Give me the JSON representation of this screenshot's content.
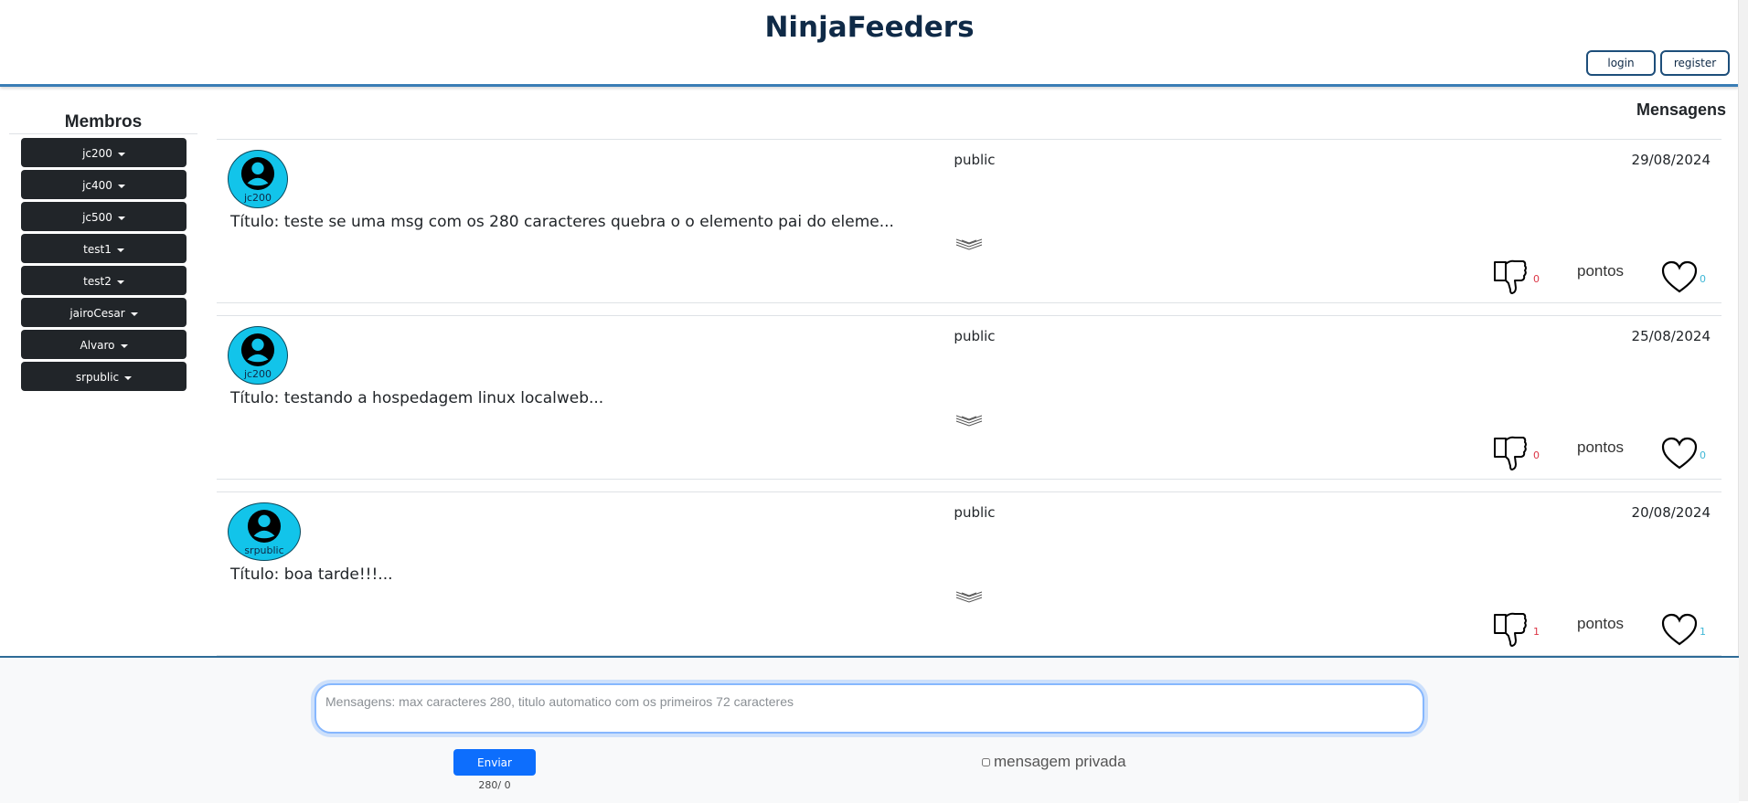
{
  "app": {
    "title": "NinjaFeeders"
  },
  "auth": {
    "login_label": "login",
    "register_label": "register"
  },
  "sidebar": {
    "title": "Membros",
    "members": [
      "jc200",
      "jc400",
      "jc500",
      "test1",
      "test2",
      "jairoCesar",
      "Alvaro",
      "srpublic"
    ]
  },
  "messages": {
    "title": "Mensagens",
    "items": [
      {
        "author": "jc200",
        "visibility": "public",
        "date": "29/08/2024",
        "title": "Título: teste se uma msg com os 280 caracteres quebra o o elemento pai do eleme...",
        "dislikes": "0",
        "points_label": "pontos",
        "likes": "0"
      },
      {
        "author": "jc200",
        "visibility": "public",
        "date": "25/08/2024",
        "title": "Título: testando a hospedagem linux localweb...",
        "dislikes": "0",
        "points_label": "pontos",
        "likes": "0"
      },
      {
        "author": "srpublic",
        "visibility": "public",
        "date": "20/08/2024",
        "title": "Título: boa tarde!!!...",
        "dislikes": "1",
        "points_label": "pontos",
        "likes": "1"
      }
    ]
  },
  "composer": {
    "placeholder": "Mensagens: max caracteres 280, titulo automatico com os primeiros 72 caracteres",
    "send_label": "Enviar",
    "counter": "280/ 0",
    "private_label": "mensagem privada"
  },
  "colors": {
    "accent": "#0d6efd",
    "header_border": "#3a7db5",
    "member_bg": "#212529",
    "avatar": "#12c4ea",
    "dislike_count": "#dc3545",
    "like_count": "#3fb7d6"
  },
  "icons": {
    "avatar": "user-circle-icon",
    "expand": "chevron-double-down-icon",
    "dislike": "thumbs-down-icon",
    "like": "heart-icon",
    "dropdown": "caret-down-icon"
  }
}
